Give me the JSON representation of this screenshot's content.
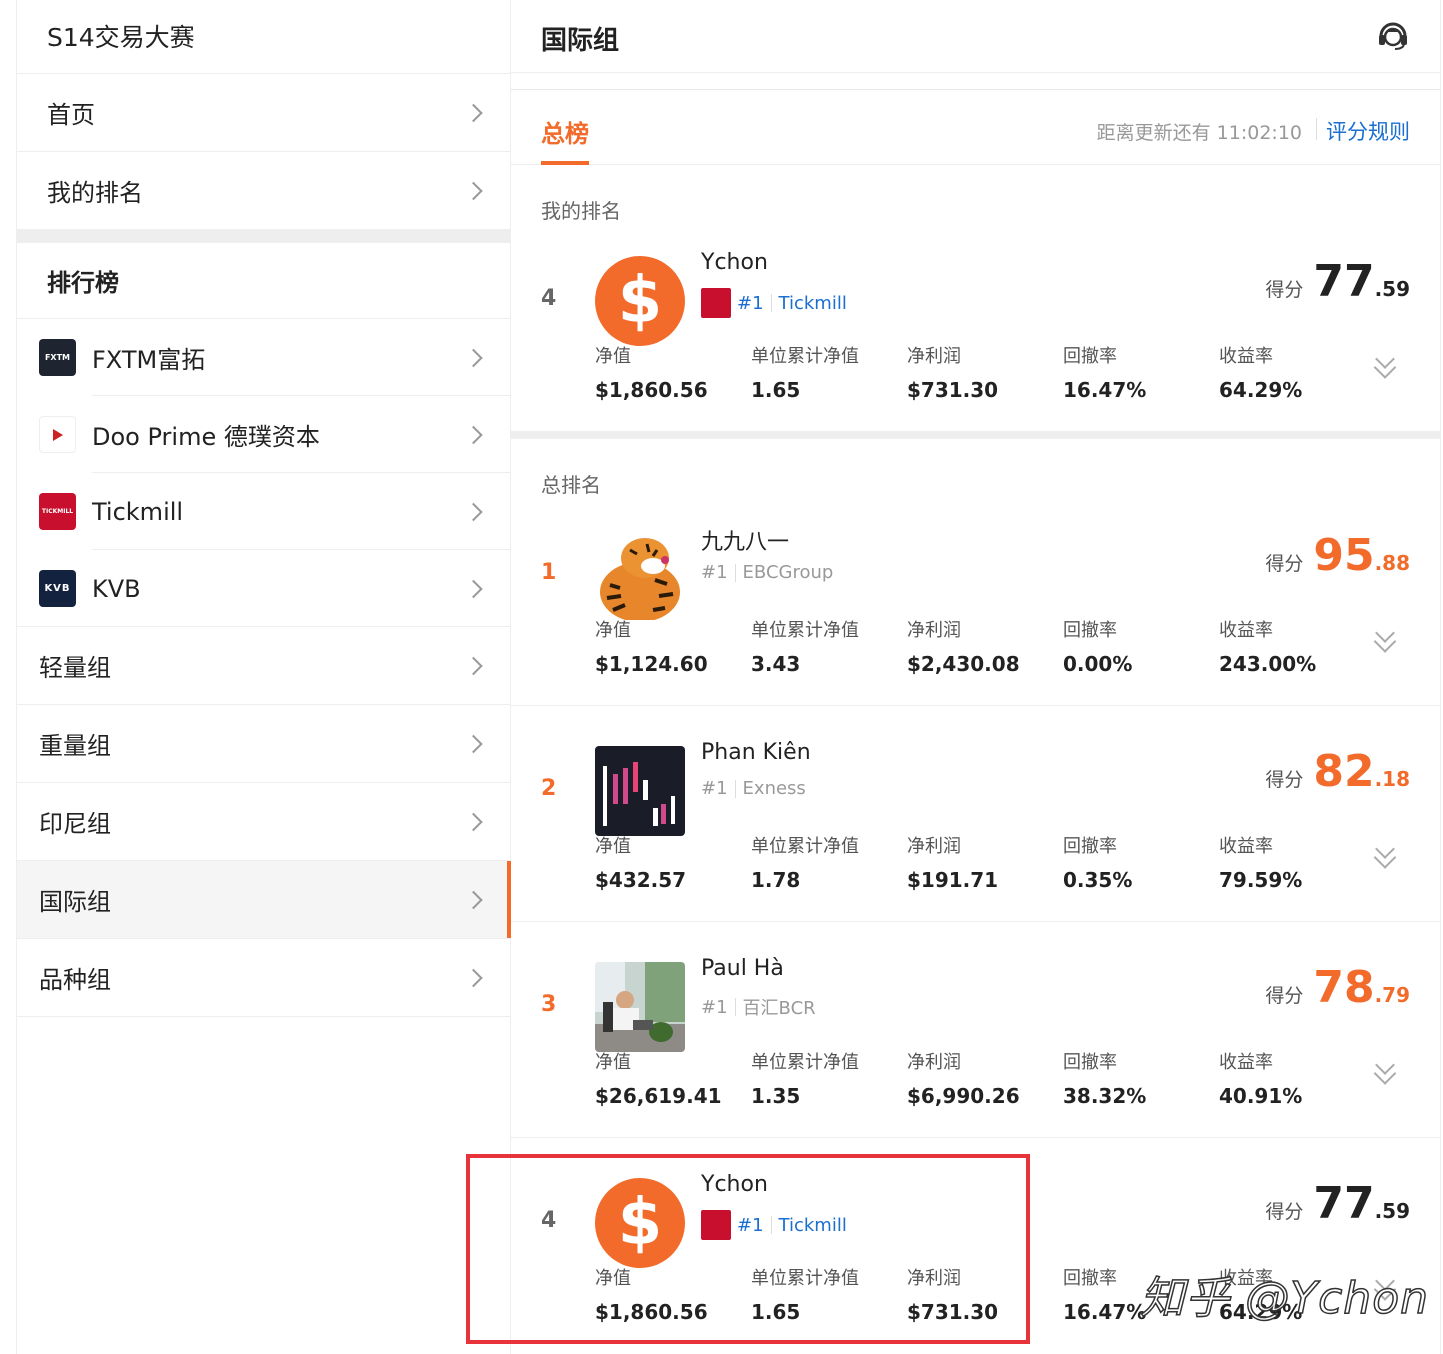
{
  "sidebar": {
    "title": "S14交易大赛",
    "nav": [
      {
        "label": "首页"
      },
      {
        "label": "我的排名"
      }
    ],
    "section_title": "排行榜",
    "brokers": [
      {
        "label": "FXTM富拓",
        "logo": "FXTM"
      },
      {
        "label": "Doo Prime 德璞资本",
        "logo": "Doo Prime"
      },
      {
        "label": "Tickmill",
        "logo": "TICKMILL"
      },
      {
        "label": "KVB",
        "logo": "KVB"
      }
    ],
    "groups": [
      {
        "label": "轻量组"
      },
      {
        "label": "重量组"
      },
      {
        "label": "印尼组"
      },
      {
        "label": "国际组"
      },
      {
        "label": "品种组"
      }
    ]
  },
  "main": {
    "title": "国际组",
    "tab_active": "总榜",
    "countdown": "距离更新还有 11:02:10",
    "rules_link": "评分规则",
    "my_rank_label": "我的排名",
    "overall_label": "总排名",
    "score_label": "得分",
    "stat_labels": [
      "净值",
      "单位累计净值",
      "净利润",
      "回撤率",
      "收益率"
    ]
  },
  "my_entry": {
    "rank": "4",
    "name": "Ychon",
    "rank_tag": "#1",
    "broker": "Tickmill",
    "score_int": "77",
    "score_dec": ".59",
    "stats": [
      "$1,860.56",
      "1.65",
      "$731.30",
      "16.47%",
      "64.29%"
    ]
  },
  "entries": [
    {
      "rank": "1",
      "name": "九九八一",
      "rank_tag": "#1",
      "broker": "EBCGroup",
      "score_int": "95",
      "score_dec": ".88",
      "stats": [
        "$1,124.60",
        "3.43",
        "$2,430.08",
        "0.00%",
        "243.00%"
      ]
    },
    {
      "rank": "2",
      "name": "Phan Kiên",
      "rank_tag": "#1",
      "broker": "Exness",
      "score_int": "82",
      "score_dec": ".18",
      "stats": [
        "$432.57",
        "1.78",
        "$191.71",
        "0.35%",
        "79.59%"
      ]
    },
    {
      "rank": "3",
      "name": "Paul Hà",
      "rank_tag": "#1",
      "broker": "百汇BCR",
      "score_int": "78",
      "score_dec": ".79",
      "stats": [
        "$26,619.41",
        "1.35",
        "$6,990.26",
        "38.32%",
        "40.91%"
      ]
    },
    {
      "rank": "4",
      "name": "Ychon",
      "rank_tag": "#1",
      "broker": "Tickmill",
      "score_int": "77",
      "score_dec": ".59",
      "stats": [
        "$1,860.56",
        "1.65",
        "$731.30",
        "16.47%",
        "64.29%"
      ]
    }
  ],
  "dollar_sign": "$",
  "watermark": "知乎 @Ychon",
  "colors": {
    "accent": "#f26b2b",
    "link": "#1a6fd0",
    "highlight": "#e8333a",
    "tickmill": "#c8102e"
  }
}
